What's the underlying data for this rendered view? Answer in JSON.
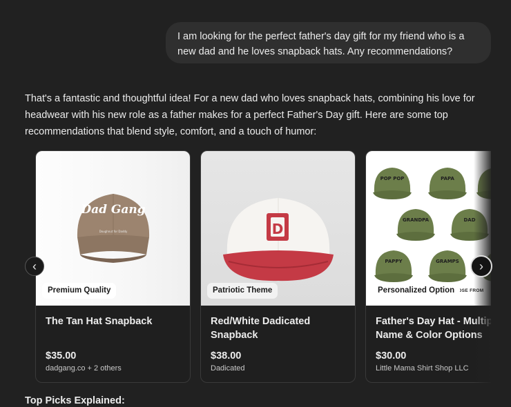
{
  "user_message": "I am looking for the perfect father's day gift for my friend who is a new dad and he loves snapback hats. Any recommendations?",
  "assistant_intro": "That's a fantastic and thoughtful idea! For a new dad who loves snapback hats, combining his love for headwear with his new role as a father makes for a perfect Father's Day gift. Here are some top recommendations that blend style, comfort, and a touch of humor:",
  "products": [
    {
      "badge": "Premium Quality",
      "title": "The Tan Hat Snapback",
      "price": "$35.00",
      "source": "dadgang.co + 2 others",
      "hat_text": "Dad Gang",
      "hat_subtext": "Doughnut for Daddy"
    },
    {
      "badge": "Patriotic Theme",
      "title": "Red/White Dadicated Snapback",
      "price": "$38.00",
      "source": "Dadicated",
      "hat_logo": "D"
    },
    {
      "badge": "Personalized Option",
      "badge_overflow": "OOSE FROM",
      "title": "Father's Day Hat - Multip Name & Color Options -...",
      "price": "$30.00",
      "source": "Little Mama Shirt Shop LLC",
      "hat_labels": [
        "POP POP",
        "PAPA",
        "GRANDPA",
        "DAD",
        "PAPPY",
        "GRAMPS"
      ]
    }
  ],
  "carousel": {
    "prev_icon": "‹",
    "next_icon": "›"
  },
  "section_heading": "Top Picks Explained:",
  "colors": {
    "background": "#212121",
    "user_bubble": "#2f2f2f",
    "card_border": "#3a3a3a",
    "text": "#ececec"
  }
}
